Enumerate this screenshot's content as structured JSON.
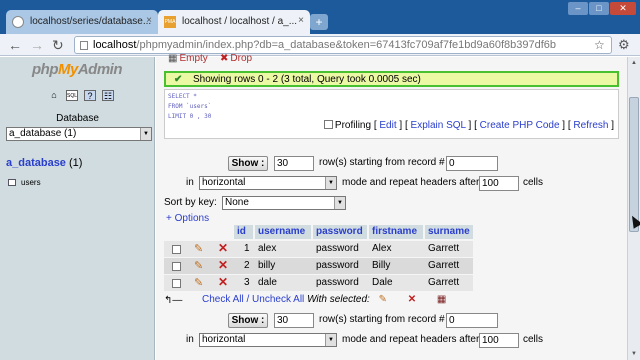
{
  "browser": {
    "tabs": [
      {
        "label": "localhost/series/database..."
      },
      {
        "label": "localhost / localhost / a_..."
      }
    ],
    "tab2_favicon_text": "PMA",
    "close_glyph": "×",
    "newtab_glyph": "+",
    "url_host": "localhost",
    "url_path": "/phpmyadmin/index.php?db=a_database&token=67413fc709af7fe1bd9a60f8b397df6b"
  },
  "sidebar": {
    "logo_php": "php",
    "logo_my": "My",
    "logo_admin": "Admin",
    "database_label": "Database",
    "database_select": "a_database (1)",
    "db_name": "a_database",
    "db_count": "(1)",
    "table_item": "users"
  },
  "main": {
    "ops": {
      "empty": "Empty",
      "drop": "Drop"
    },
    "success_message": "Showing rows 0 - 2 (3 total, Query took 0.0005 sec)",
    "sql": [
      "SELECT *",
      "FROM `users`",
      "LIMIT 0 , 30"
    ],
    "sql_links": {
      "profiling": "Profiling",
      "edit": "Edit",
      "explain": "Explain SQL",
      "php": "Create PHP Code",
      "refresh": "Refresh"
    },
    "nav_top": {
      "show_label": "Show :",
      "rows_value": "30",
      "rows_text": "row(s) starting from record #",
      "start_value": "0",
      "in_label": "in",
      "mode_select": "horizontal",
      "mode_text": "mode and repeat headers after",
      "repeat_value": "100",
      "cells_text": "cells"
    },
    "sort_label": "Sort by key:",
    "sort_select": "None",
    "options_link": "+ Options",
    "table": {
      "columns": [
        "id",
        "username",
        "password",
        "firstname",
        "surname"
      ],
      "rows": [
        [
          "1",
          "alex",
          "password",
          "Alex",
          "Garrett"
        ],
        [
          "2",
          "billy",
          "password",
          "Billy",
          "Garrett"
        ],
        [
          "3",
          "dale",
          "password",
          "Dale",
          "Garrett"
        ]
      ]
    },
    "with_selected": {
      "check_all": "Check All",
      "sep": " / ",
      "uncheck_all": "Uncheck All",
      "label": "With selected:"
    },
    "nav_bottom": {
      "show_label": "Show :",
      "rows_value": "30",
      "rows_text": "row(s) starting from record #",
      "start_value": "0",
      "in_label": "in",
      "mode_select": "horizontal",
      "mode_text": "mode and repeat headers after",
      "repeat_value": "100",
      "cells_text": "cells"
    }
  },
  "icons": {
    "back": "back-arrow-icon",
    "forward": "forward-arrow-icon",
    "reload": "reload-icon",
    "star": "star-icon",
    "wrench": "wrench-icon",
    "edit": "pencil-icon",
    "delete": "red-x-icon",
    "export": "export-icon"
  },
  "colors": {
    "tab_bar": "#1d5a9c",
    "link": "#2a3ecc",
    "success_border": "#48c030",
    "success_bg": "#ebf8a4",
    "sidebar_bg": "#d0dce0"
  }
}
